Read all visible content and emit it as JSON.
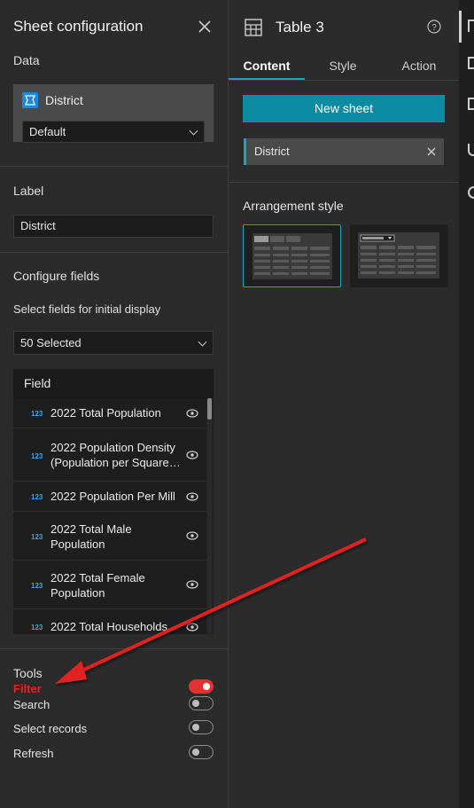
{
  "panel": {
    "title": "Sheet configuration",
    "data_section": "Data",
    "data_source": "District",
    "view_select": "Default",
    "label_section": "Label",
    "label_value": "District",
    "configure_section": "Configure fields",
    "select_hint": "Select fields for initial display",
    "selected_count": "50 Selected",
    "field_header": "Field",
    "fields": [
      {
        "type": "123",
        "label": "2022 Total Population"
      },
      {
        "type": "123",
        "label": "2022 Population Density (Population per Square…"
      },
      {
        "type": "123",
        "label": "2022 Population Per Mill"
      },
      {
        "type": "123",
        "label": "2022 Total Male Population"
      },
      {
        "type": "123",
        "label": "2022 Total Female Population"
      },
      {
        "type": "123",
        "label": "2022 Total Households"
      }
    ],
    "tools_section": "Tools",
    "tools": [
      {
        "label": "Filter",
        "on": true
      },
      {
        "label": "Search",
        "on": false
      },
      {
        "label": "Select records",
        "on": false
      },
      {
        "label": "Refresh",
        "on": false
      }
    ]
  },
  "widget": {
    "title": "Table 3",
    "tabs": [
      "Content",
      "Style",
      "Action"
    ],
    "active_tab": "Content",
    "new_sheet_label": "New sheet",
    "sheet_chip": "District",
    "arrangement_label": "Arrangement style"
  },
  "colors": {
    "accent": "#1aa5bf",
    "annotation_red": "#e02020"
  },
  "icons": [
    "close-icon",
    "table-icon",
    "help-icon",
    "eye-icon",
    "chevron-down-icon"
  ]
}
